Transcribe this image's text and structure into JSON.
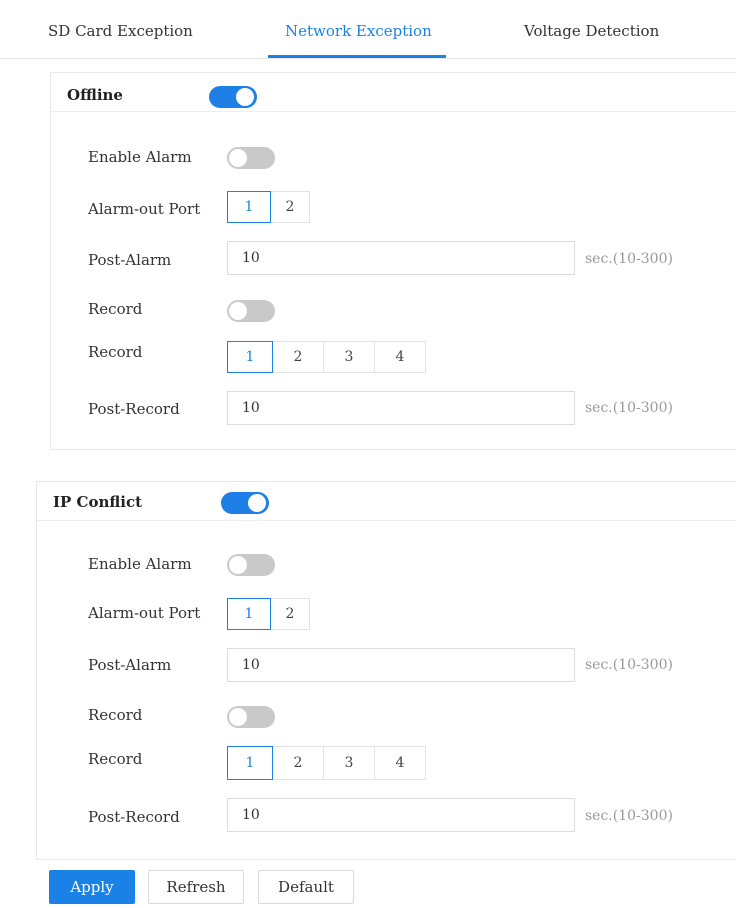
{
  "tabs": [
    {
      "label": "SD Card Exception"
    },
    {
      "label": "Network Exception"
    },
    {
      "label": "Voltage Detection"
    }
  ],
  "active_tab": "Network Exception",
  "accent_color": "#1a82e6",
  "offline": {
    "title": "Offline",
    "enabled": true,
    "enable_alarm_label": "Enable Alarm",
    "enable_alarm_on": false,
    "alarm_out_label": "Alarm-out Port",
    "alarm_ports": [
      "1",
      "2"
    ],
    "alarm_port_selected": "1",
    "post_alarm_label": "Post-Alarm",
    "post_alarm_value": "10",
    "post_alarm_unit": "sec.(10-300)",
    "record_toggle_label": "Record",
    "record_on": false,
    "record_channels_label": "Record",
    "record_channels": [
      "1",
      "2",
      "3",
      "4"
    ],
    "record_channel_selected": "1",
    "post_record_label": "Post-Record",
    "post_record_value": "10",
    "post_record_unit": "sec.(10-300)"
  },
  "ip_conflict": {
    "title": "IP Conflict",
    "enabled": true,
    "enable_alarm_label": "Enable Alarm",
    "enable_alarm_on": false,
    "alarm_out_label": "Alarm-out Port",
    "alarm_ports": [
      "1",
      "2"
    ],
    "alarm_port_selected": "1",
    "post_alarm_label": "Post-Alarm",
    "post_alarm_value": "10",
    "post_alarm_unit": "sec.(10-300)",
    "record_toggle_label": "Record",
    "record_on": false,
    "record_channels_label": "Record",
    "record_channels": [
      "1",
      "2",
      "3",
      "4"
    ],
    "record_channel_selected": "1",
    "post_record_label": "Post-Record",
    "post_record_value": "10",
    "post_record_unit": "sec.(10-300)"
  },
  "actions": {
    "apply": "Apply",
    "refresh": "Refresh",
    "default": "Default"
  }
}
